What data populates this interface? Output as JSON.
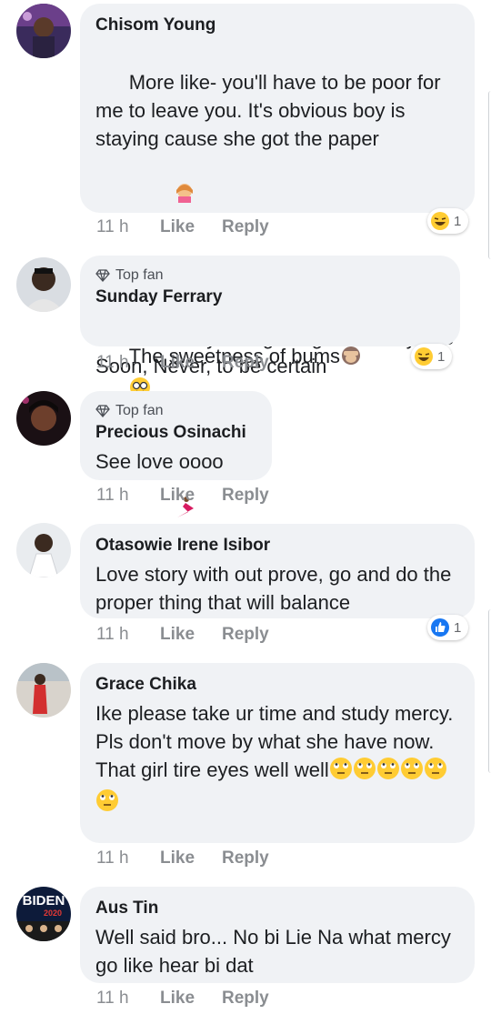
{
  "comments": [
    {
      "author": "Chisom Young",
      "badge": "",
      "text": "More like- you'll have to be poor for me to leave you. It's obvious boy is staying cause she got the paper",
      "text2": "but Mercy isn't getting broke anytime Soon, Never, to be certain",
      "time": "11 h",
      "like": "Like",
      "reply": "Reply",
      "reaction_count": "1",
      "reaction_icon": "laughing-face"
    },
    {
      "author": "Sunday Ferrary",
      "badge": "Top fan",
      "text": "The sweetness of bums",
      "time": "11 h",
      "like": "Like",
      "reply": "Reply",
      "reaction_count": "1",
      "reaction_icon": "laughing-face"
    },
    {
      "author": "Precious Osinachi",
      "badge": "Top fan",
      "text": "See love oooo",
      "time": "11 h",
      "like": "Like",
      "reply": "Reply"
    },
    {
      "author": "Otasowie Irene Isibor",
      "badge": "",
      "text": "Love story with out prove, go and do the proper thing that will balance",
      "time": "11 h",
      "like": "Like",
      "reply": "Reply",
      "reaction_count": "1",
      "reaction_icon": "like-thumb"
    },
    {
      "author": "Grace Chika",
      "badge": "",
      "text": "Ike please take ur time and study mercy. Pls don't move by what she have now.\nThat girl tire eyes well well",
      "time": "11 h",
      "like": "Like",
      "reply": "Reply"
    },
    {
      "author": "Aus Tin",
      "badge": "",
      "text": "Well said bro... No bi Lie Na what mercy go like hear bi dat",
      "time": "11 h",
      "like": "Like",
      "reply": "Reply",
      "avatar_text": "BIDEN",
      "avatar_subtext": "2020"
    }
  ],
  "colors": {
    "bubble": "#f0f2f5",
    "meta": "#8a8d91",
    "like_blue": "#1877f2",
    "emoji_yellow": "#ffcc33"
  }
}
